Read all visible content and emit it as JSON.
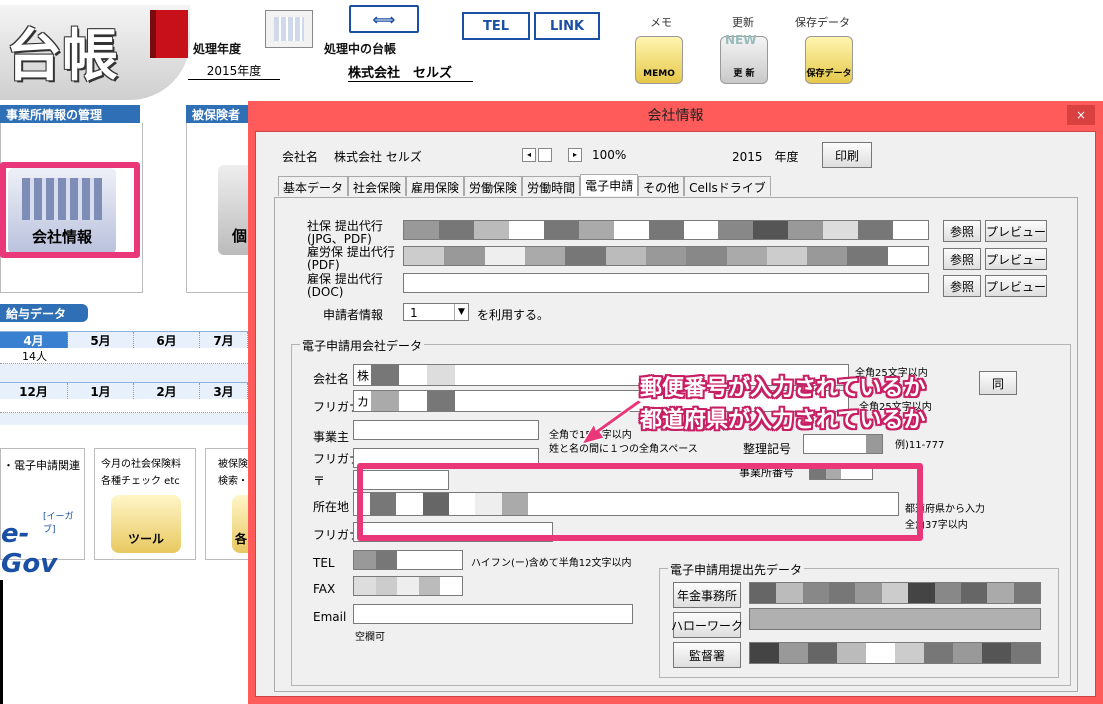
{
  "app": {
    "logo_text": "台帳",
    "year_label": "処理年度",
    "year_value": "2015年度",
    "ledger_label": "処理中の台帳",
    "company_value": "株式会社　セルズ",
    "tel_button": "TEL",
    "link_button": "LINK",
    "memo_caption": "メモ",
    "memo_icon_label": "MEMO",
    "update_caption": "更新",
    "update_icon_label": "更 新",
    "update_badge": "NEW",
    "save_caption": "保存データ",
    "save_icon_label": "保存データ",
    "section_office": "事業所情報の管理",
    "section_insured": "被保険者",
    "company_info_tile": "会社情報",
    "partial_tile": "個",
    "salary_section": "給与データ",
    "months_row1": [
      "4月",
      "5月",
      "6月",
      "7月"
    ],
    "months_row2": [
      "12月",
      "1月",
      "2月",
      "3月"
    ],
    "count_cell": "14人",
    "egov_caption": "・電子申請関連",
    "egov_logo": "e-Gov",
    "egov_sub": "[イーガブ]",
    "shaho_caption1": "今月の社会保険料",
    "shaho_caption2": "各種チェック etc",
    "tool_label": "ツール",
    "hoken_caption1": "被保険",
    "hoken_caption2": "検索・",
    "pin_char": "各"
  },
  "dialog": {
    "title": "会社情報",
    "close": "×",
    "company_label": "会社名",
    "company_value": "株式会社 セルズ",
    "zoom": "100%",
    "year": "2015　年度",
    "print_button": "印刷",
    "tabs": [
      "基本データ",
      "社会保険",
      "雇用保険",
      "労働保険",
      "労働時間",
      "電子申請",
      "その他",
      "Cellsドライブ"
    ],
    "active_tab": 5,
    "rows": [
      {
        "label1": "社保 提出代行",
        "label2": "(JPG、PDF)"
      },
      {
        "label1": "雇労保 提出代行",
        "label2": "(PDF)"
      },
      {
        "label1": "雇保 提出代行",
        "label2": "(DOC)"
      }
    ],
    "browse_button": "参照",
    "preview_button": "プレビュー",
    "applicant_label": "申請者情報",
    "applicant_value": "1",
    "applicant_suffix": "を利用する。",
    "group_title": "電子申請用会社データ",
    "fields": {
      "company_name": "会社名",
      "company_value_char": "株",
      "furigana": "フリガナ",
      "furigana_value_char": "カ",
      "employer": "事業主",
      "employer_furigana": "フリガナ",
      "postal": "〒",
      "address": "所在地",
      "address_furigana": "フリガナ",
      "tel": "TEL",
      "fax": "FAX",
      "email": "Email"
    },
    "hints": {
      "company_chars": "全角25文字以内",
      "same_button": "同",
      "furigana_chars": "全角25文字以内",
      "employer_hint1": "全角で15文字以内",
      "employer_hint2": "姓と名の間に１つの全角スペース",
      "office_code_label": "整理記号",
      "office_code_example": "例)11-777",
      "office_number_label": "事業所番号",
      "address_hint1": "都道府県から入力",
      "address_hint2": "全角37字以内",
      "tel_hint": "ハイフン(ー)含めて半角12文字以内",
      "email_hint": "空欄可"
    },
    "dest_group_title": "電子申請用提出先データ",
    "dest_buttons": [
      "年金事務所",
      "ハローワーク",
      "監督署"
    ]
  },
  "annotation": {
    "line1": "郵便番号が入力されているか",
    "line2": "都道府県が入力されているか"
  },
  "colors": {
    "dialog_frame": "#ff5b5b",
    "highlight": "#e9377a",
    "section_blue": "#2f6fb6"
  }
}
